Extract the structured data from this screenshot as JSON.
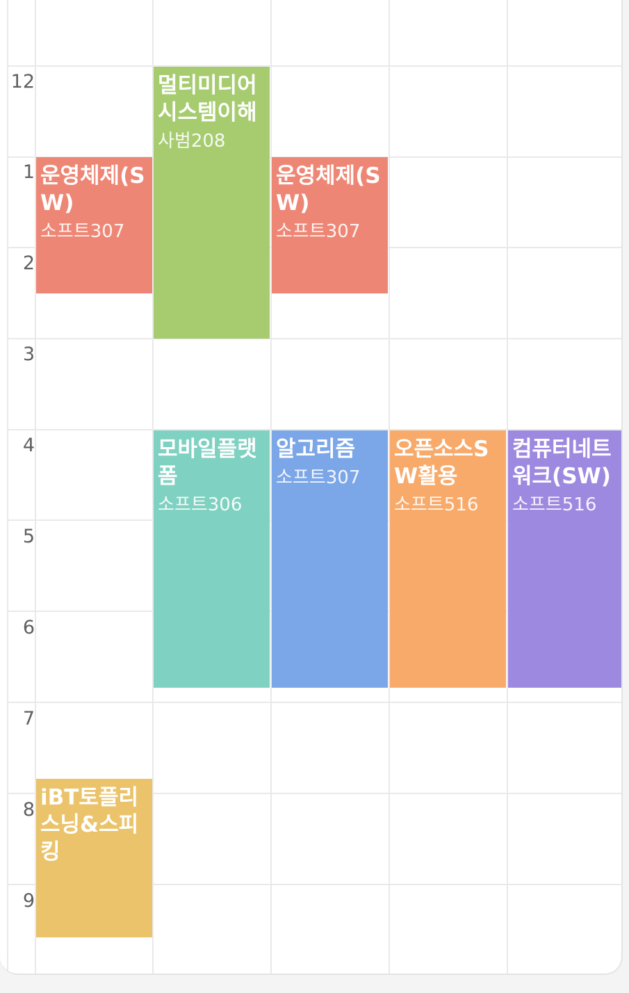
{
  "hours": [
    "12",
    "1",
    "2",
    "3",
    "4",
    "5",
    "6",
    "7",
    "8",
    "9"
  ],
  "courses": [
    {
      "title": "운영체제(SW)",
      "room": "소프트307",
      "color": "#ee8675"
    },
    {
      "title": "멀티미디어시스템이해",
      "room": "사범208",
      "color": "#a6cc6f"
    },
    {
      "title": "운영체제(SW)",
      "room": "소프트307",
      "color": "#ee8675"
    },
    {
      "title": "모바일플랫폼",
      "room": "소프트306",
      "color": "#7fd1c1"
    },
    {
      "title": "알고리즘",
      "room": "소프트307",
      "color": "#7ba6e8"
    },
    {
      "title": "오픈소스SW활용",
      "room": "소프트516",
      "color": "#f8aa6b"
    },
    {
      "title": "컴퓨터네트워크(SW)",
      "room": "소프트516",
      "color": "#9e89e0"
    },
    {
      "title": "iBT토플리스닝&스피킹",
      "room": "",
      "color": "#eac36b"
    }
  ]
}
